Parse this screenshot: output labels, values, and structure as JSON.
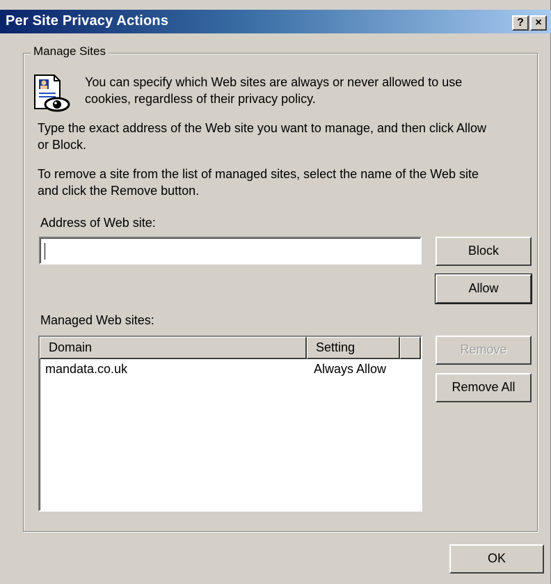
{
  "window": {
    "title": "Per Site Privacy Actions",
    "help_label": "?",
    "close_label": "×"
  },
  "group": {
    "label": "Manage Sites"
  },
  "text": {
    "intro_line1": "You can specify which Web sites are always or never allowed to use",
    "intro_line2": "cookies, regardless of their privacy policy.",
    "type_line1": "Type the exact address of the Web site you want to manage, and then click Allow",
    "type_line2": "or Block.",
    "remove_line1": "To remove a site from the list of managed sites, select the name of the Web site",
    "remove_line2": "and click the Remove button.",
    "address_label": "Address of Web site:",
    "managed_label": "Managed Web sites:"
  },
  "address_input": {
    "value": ""
  },
  "buttons": {
    "block": "Block",
    "allow": "Allow",
    "remove": "Remove",
    "remove_all": "Remove All",
    "ok": "OK"
  },
  "managed_sites": {
    "columns": [
      "Domain",
      "Setting"
    ],
    "rows": [
      {
        "domain": "mandata.co.uk",
        "setting": "Always Allow"
      }
    ]
  }
}
